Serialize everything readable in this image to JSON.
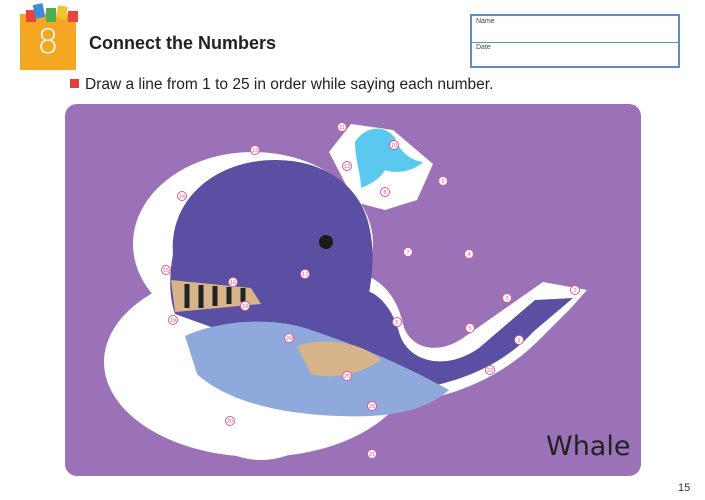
{
  "header": {
    "lesson_number": "8",
    "title": "Connect the Numbers"
  },
  "name_box": {
    "name_label": "Name",
    "date_label": "Date"
  },
  "instruction": {
    "before": "Draw a line from ",
    "start": "1",
    "middle": " to ",
    "end": "25",
    "after": " in order while saying each number."
  },
  "puzzle": {
    "caption": "Whale",
    "background_color": "#9b72b8",
    "whale_color": "#5b4fa3",
    "belly_color": "#8fa9dc",
    "spout_color": "#5bc8f0",
    "dot_color": "#e0569a",
    "dots": [
      "1",
      "2",
      "3",
      "4",
      "5",
      "6",
      "7",
      "8",
      "9",
      "10",
      "11",
      "12",
      "13",
      "14",
      "15",
      "16",
      "17",
      "18",
      "19",
      "20",
      "21",
      "22",
      "23",
      "24",
      "25"
    ]
  },
  "page_number": "15"
}
